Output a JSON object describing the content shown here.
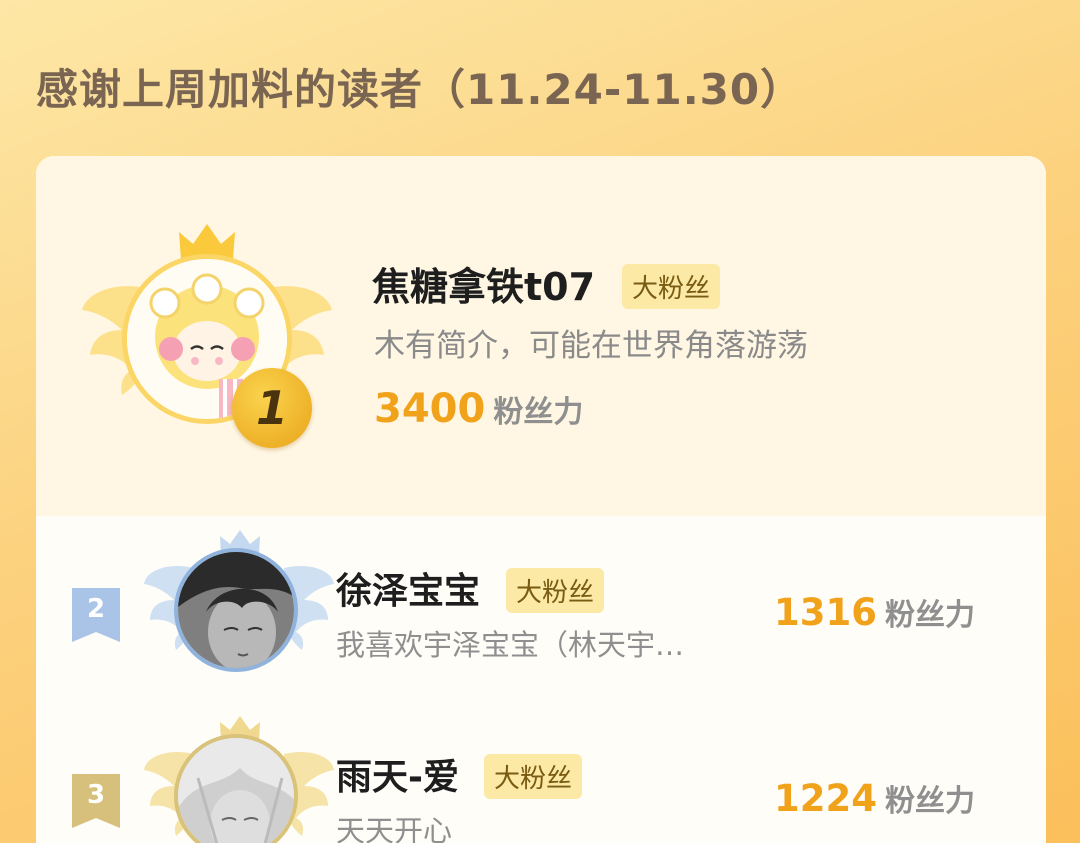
{
  "page": {
    "title": "感谢上周加料的读者（11.24-11.30）"
  },
  "colors": {
    "accent_orange": "#f1a21b",
    "badge_bg": "#fbe9a5",
    "rank2_blue": "#8fb3dc",
    "rank3_gold": "#d9c27a"
  },
  "top_reader": {
    "rank": "1",
    "name": "焦糖拿铁t07",
    "badge": "大粉丝",
    "description": "木有简介，可能在世界角落游荡",
    "score": "3400",
    "score_unit": "粉丝力",
    "avatar_icon": "cartoon-girl-avatar",
    "crown_icon": "crown-icon"
  },
  "readers": [
    {
      "rank": "2",
      "name": "徐泽宝宝",
      "badge": "大粉丝",
      "description": "我喜欢宇泽宝宝（林天宇…",
      "score": "1316",
      "score_unit": "粉丝力",
      "avatar_icon": "anime-boy-avatar"
    },
    {
      "rank": "3",
      "name": "雨天-爱",
      "badge": "大粉丝",
      "description": "天天开心",
      "score": "1224",
      "score_unit": "粉丝力",
      "avatar_icon": "anime-white-hair-avatar"
    }
  ]
}
